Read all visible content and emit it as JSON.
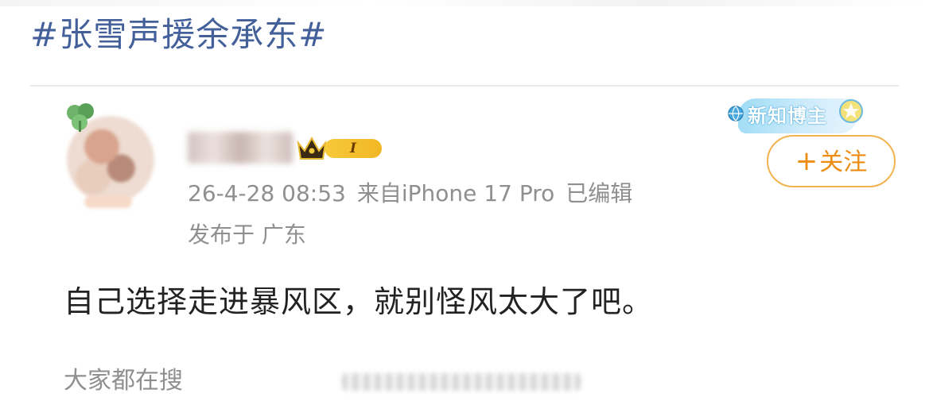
{
  "topic": {
    "title": "#张雪声援余承东#"
  },
  "post": {
    "author": {
      "level_badge": "I",
      "new_blogger_label": "新知博主"
    },
    "timestamp": "26-4-28 08:53",
    "source": "来自iPhone 17 Pro",
    "edited": "已编辑",
    "location": "发布于 广东",
    "follow_label": "关注",
    "follow_plus": "+",
    "content": "自己选择走进暴风区，就别怪风太大了吧。"
  },
  "related_search": {
    "label": "大家都在搜"
  },
  "colors": {
    "hashtag": "#44609a",
    "follow_accent": "#ec8c12",
    "meta_text": "#8f8f8f",
    "body_text": "#222222",
    "level_gold": "#f6c93c"
  },
  "icons": [
    "crown-icon",
    "leaf-icon",
    "globe-icon",
    "star-icon"
  ]
}
